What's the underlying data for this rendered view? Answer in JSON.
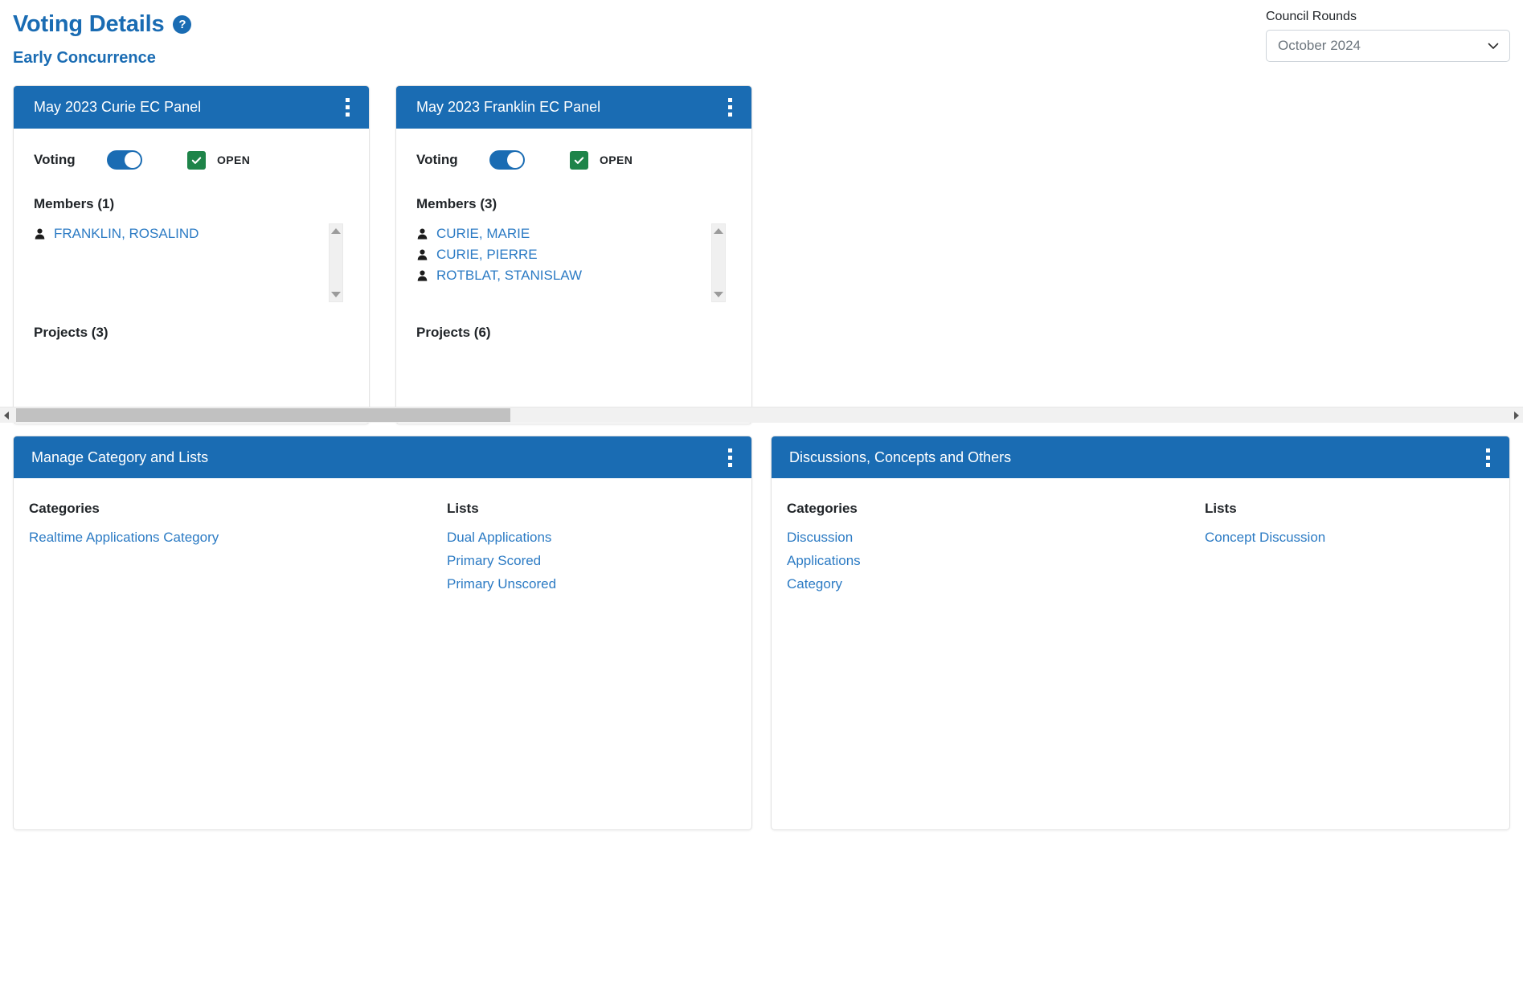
{
  "header": {
    "title": "Voting Details",
    "help_icon": "question-mark-circle-icon",
    "subtitle": "Early Concurrence"
  },
  "council_rounds": {
    "label": "Council Rounds",
    "selected": "October 2024",
    "chevron_icon": "chevron-down-icon"
  },
  "panels": [
    {
      "title": "May 2023 Curie EC Panel",
      "menu_icon": "kebab-menu-icon",
      "voting_label": "Voting",
      "voting_enabled": true,
      "status_label": "OPEN",
      "status_checked": true,
      "members_label": "Members (1)",
      "members": [
        "FRANKLIN, ROSALIND"
      ],
      "projects_label": "Projects (3)"
    },
    {
      "title": "May 2023 Franklin EC Panel",
      "menu_icon": "kebab-menu-icon",
      "voting_label": "Voting",
      "voting_enabled": true,
      "status_label": "OPEN",
      "status_checked": true,
      "members_label": "Members (3)",
      "members": [
        "CURIE, MARIE",
        "CURIE, PIERRE",
        "ROTBLAT, STANISLAW"
      ],
      "projects_label": "Projects (6)"
    }
  ],
  "bottom_panels": [
    {
      "title": "Manage Category and Lists",
      "menu_icon": "kebab-menu-icon",
      "categories_heading": "Categories",
      "categories": [
        "Realtime Applications Category"
      ],
      "lists_heading": "Lists",
      "lists": [
        "Dual Applications",
        "Primary Scored",
        "Primary Unscored"
      ]
    },
    {
      "title": "Discussions, Concepts and Others",
      "menu_icon": "kebab-menu-icon",
      "categories_heading": "Categories",
      "categories": [
        "Discussion",
        "Applications",
        "Category"
      ],
      "lists_heading": "Lists",
      "lists": [
        "Concept Discussion"
      ]
    }
  ],
  "scrollbars": {
    "horizontal_left_arrow": "scroll-left-arrow-icon",
    "horizontal_right_arrow": "scroll-right-arrow-icon",
    "vertical_up_arrow": "scroll-up-arrow-icon",
    "vertical_down_arrow": "scroll-down-arrow-icon"
  },
  "colors": {
    "brand_blue": "#1a6cb3",
    "link_blue": "#2c7bc4",
    "status_green": "#1e8449"
  }
}
